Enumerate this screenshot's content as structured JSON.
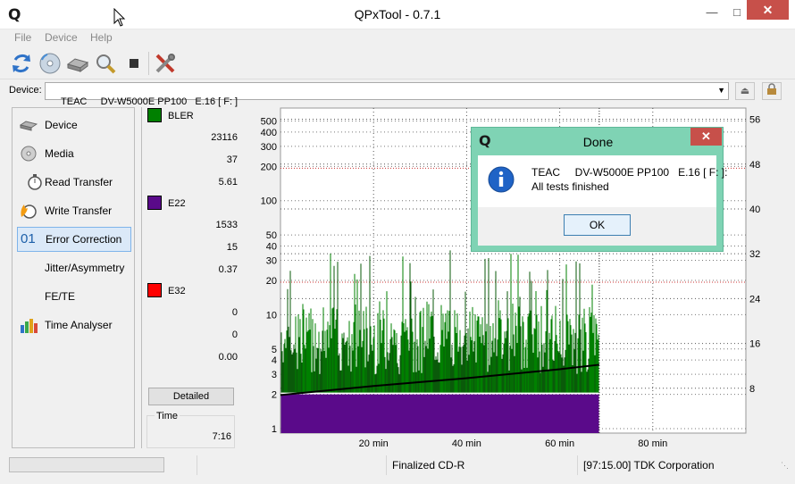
{
  "window": {
    "title": "QPxTool - 0.7.1",
    "app_letter": "Q"
  },
  "menu": [
    {
      "label": "File"
    },
    {
      "label": "Device"
    },
    {
      "label": "Help"
    }
  ],
  "toolbar": {
    "buttons": [
      {
        "icon": "refresh-icon"
      },
      {
        "icon": "disc-info-icon"
      },
      {
        "icon": "drive-icon"
      },
      {
        "icon": "scan-magnifier-icon"
      },
      {
        "icon": "stop-icon"
      },
      {
        "icon": "settings-tools-icon"
      }
    ]
  },
  "device": {
    "label": "Device:",
    "value": "TEAC     DV-W5000E PP100   E.16 [ F: ]"
  },
  "nav": [
    {
      "label": "Device",
      "icon": "drive-icon"
    },
    {
      "label": "Media",
      "icon": "disc-icon"
    },
    {
      "label": "Read Transfer",
      "icon": "stopwatch-icon"
    },
    {
      "label": "Write Transfer",
      "icon": "burn-icon"
    },
    {
      "label": "Error Correction",
      "icon": "01",
      "selected": true
    },
    {
      "label": "Jitter/Asymmetry",
      "icon": ""
    },
    {
      "label": "FE/TE",
      "icon": ""
    },
    {
      "label": "Time Analyser",
      "icon": "bar-chart-icon"
    }
  ],
  "stats": {
    "bler": {
      "name": "BLER",
      "color": "#008000",
      "total": "23116",
      "max": "37",
      "avg": "5.61"
    },
    "e22": {
      "name": "E22",
      "color": "#5a0a8a",
      "total": "1533",
      "max": "15",
      "avg": "0.37"
    },
    "e32": {
      "name": "E32",
      "color": "#ff0000",
      "total": "0",
      "max": "0",
      "avg": "0.00"
    },
    "detailed_label": "Detailed",
    "time_label": "Time",
    "time_value": "7:16"
  },
  "status": {
    "media": "Finalized CD-R",
    "manufacturer": "[97:15.00] TDK Corporation"
  },
  "dialog": {
    "title": "Done",
    "line1": "TEAC     DV-W5000E PP100   E.16 [ F: ]:",
    "line2": "All tests finished",
    "ok_label": "OK"
  },
  "chart_data": {
    "type": "line",
    "title": "",
    "xlabel": "",
    "ylabel": "",
    "x_unit": "min",
    "xlim": [
      0,
      100
    ],
    "x_ticks": [
      "20 min",
      "40 min",
      "60 min",
      "80 min"
    ],
    "y_left_scale": "log",
    "y_left_ticks": [
      "1",
      "2",
      "3",
      "4",
      "5",
      "10",
      "20",
      "30",
      "40",
      "50",
      "100",
      "200",
      "300",
      "400",
      "500"
    ],
    "y_right_ticks": [
      "8",
      "16",
      "24",
      "32",
      "40",
      "48",
      "56"
    ],
    "ylim_right": [
      0,
      58
    ],
    "series": [
      {
        "name": "BLER",
        "color": "#008000",
        "x_range": [
          0,
          68.5
        ],
        "typical": [
          3,
          10
        ],
        "peak": 37
      },
      {
        "name": "E22",
        "color": "#5a0a8a",
        "x_range": [
          0,
          68.5
        ],
        "level": 2
      },
      {
        "name": "E32",
        "color": "#ff0000",
        "x_range": [
          0,
          68.5
        ],
        "level": 0
      }
    ],
    "speed": {
      "color": "#000000",
      "x": [
        0,
        20,
        40,
        60,
        68.5
      ],
      "y": [
        6.8,
        8.4,
        9.8,
        11.4,
        12.2
      ]
    },
    "end_marker_x": 68.5
  }
}
